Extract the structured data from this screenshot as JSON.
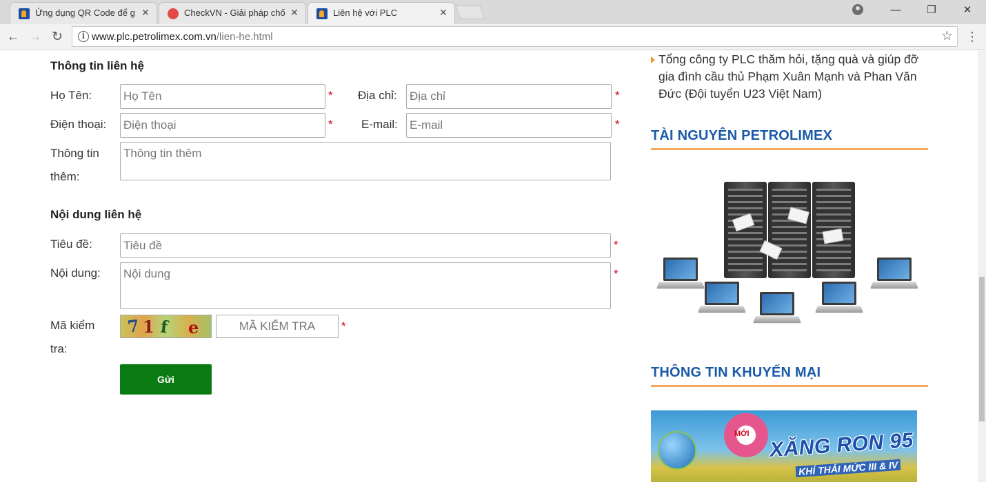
{
  "browser": {
    "tabs": [
      {
        "title": "Ứng dụng QR Code để g",
        "favicon": "plc-favicon",
        "active": false
      },
      {
        "title": "CheckVN - Giải pháp chố",
        "favicon": "checkvn-favicon",
        "active": false
      },
      {
        "title": "Liên hệ với PLC",
        "favicon": "plc-favicon",
        "active": true
      }
    ],
    "url_host": "www.plc.petrolimex.com.vn",
    "url_path": "/lien-he.html"
  },
  "contact_form": {
    "section_contact_info": "Thông tin liên hệ",
    "name_label": "Họ Tên:",
    "name_placeholder": "Họ Tên",
    "address_label": "Địa chỉ:",
    "address_placeholder": "Địa chỉ",
    "phone_label": "Điện thoại:",
    "phone_placeholder": "Điện thoại",
    "email_label": "E-mail:",
    "email_placeholder": "E-mail",
    "extra_label_line1": "Thông tin",
    "extra_label_line2": "thêm:",
    "extra_placeholder": "Thông tin thêm",
    "section_content": "Nội dung liên hệ",
    "subject_label": "Tiêu đề:",
    "subject_placeholder": "Tiêu đề",
    "body_label": "Nội dung:",
    "body_placeholder": "Nội dung",
    "captcha_label_line1": "Mã kiểm",
    "captcha_label_line2": "tra:",
    "captcha_chars": [
      "7",
      "1",
      "f",
      "e"
    ],
    "captcha_placeholder": "MÃ KIỂM TRA",
    "required_mark": "*",
    "submit_label": "Gửi"
  },
  "sidebar": {
    "news_item": "Tổng công ty PLC thăm hỏi, tặng quà và giúp đỡ gia đình cầu thủ Phạm Xuân Mạnh và Phan Văn Đức (Đội tuyển U23 Việt Nam)",
    "resources_title": "TÀI NGUYÊN PETROLIMEX",
    "promo_title": "THÔNG TIN KHUYẾN MẠI",
    "promo_banner": {
      "badge": "MỚI",
      "headline": "XĂNG RON 95",
      "subline": "KHÍ THẢI MỨC III & IV"
    }
  },
  "colors": {
    "accent_blue": "#1a5aa8",
    "accent_orange": "#f5a75c",
    "submit_green": "#0a7b12",
    "required_red": "#d0021b"
  }
}
